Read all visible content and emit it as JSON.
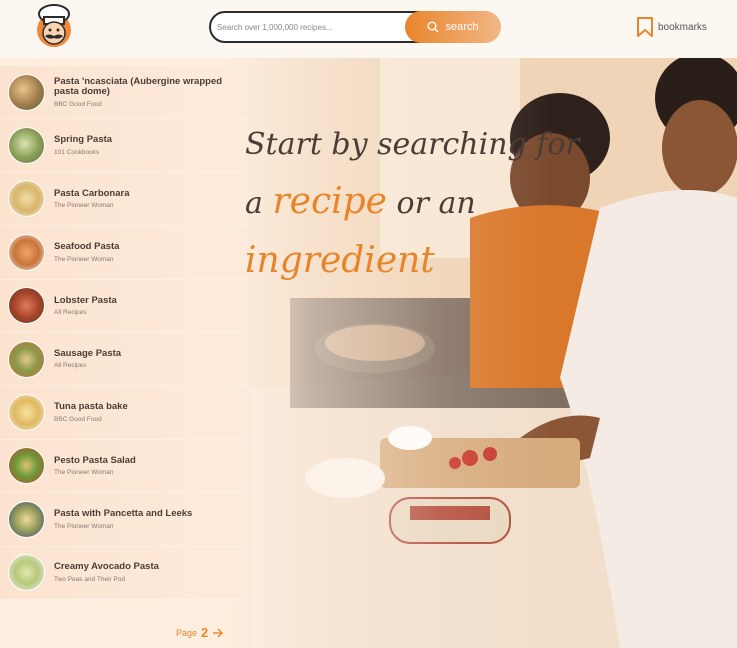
{
  "header": {
    "search_placeholder": "Search over 1,000,000 recipes...",
    "search_label": "search",
    "bookmarks_label": "bookmarks"
  },
  "hero": {
    "line1": "Start by searching for",
    "line2_a": "a",
    "line2_accent": "recipe",
    "line2_b": "or an",
    "line3_accent": "ingredient"
  },
  "results": [
    {
      "title": "Pasta 'ncasciata (Aubergine wrapped pasta dome)",
      "source": "BBC Good Food"
    },
    {
      "title": "Spring Pasta",
      "source": "101 Cookbooks"
    },
    {
      "title": "Pasta Carbonara",
      "source": "The Pioneer Woman"
    },
    {
      "title": "Seafood Pasta",
      "source": "The Pioneer Woman"
    },
    {
      "title": "Lobster Pasta",
      "source": "All Recipes"
    },
    {
      "title": "Sausage Pasta",
      "source": "All Recipes"
    },
    {
      "title": "Tuna pasta bake",
      "source": "BBC Good Food"
    },
    {
      "title": "Pesto Pasta Salad",
      "source": "The Pioneer Woman"
    },
    {
      "title": "Pasta with Pancetta and Leeks",
      "source": "The Pioneer Woman"
    },
    {
      "title": "Creamy Avocado Pasta",
      "source": "Two Peas and Their Pod"
    }
  ],
  "pagination": {
    "word": "Page",
    "number": "2"
  },
  "colors": {
    "accent": "#e8852a",
    "text": "#4a3d36",
    "background": "#fdeee0"
  },
  "icons": {
    "logo": "chef-logo-icon",
    "search": "search-icon",
    "bookmark": "bookmark-icon",
    "next": "arrow-right-icon"
  }
}
